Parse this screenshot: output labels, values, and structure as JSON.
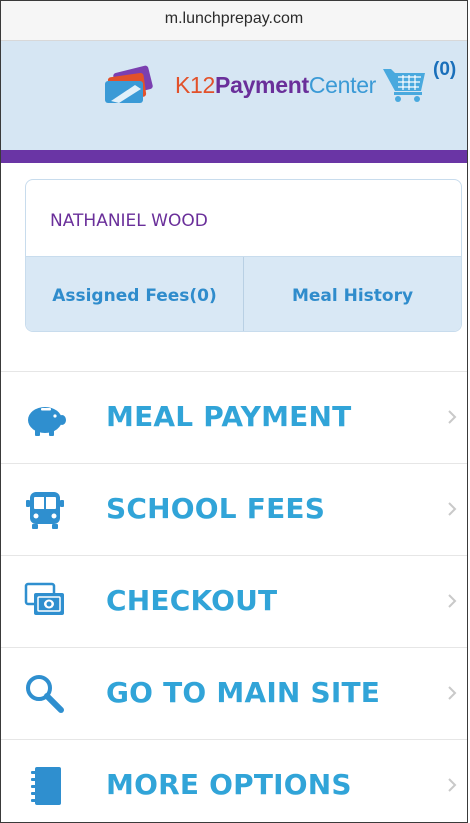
{
  "browser": {
    "url": "m.lunchprepay.com"
  },
  "header": {
    "logo": {
      "part1": "K12",
      "part2": "Payment",
      "part3": "Center"
    },
    "cart_count": "(0)",
    "accent_color": "#6a35a5",
    "header_bg": "#d6e6f3"
  },
  "student": {
    "name": "NATHANIEL WOOD",
    "links": [
      {
        "label": "Assigned Fees(0)"
      },
      {
        "label": "Meal History"
      }
    ]
  },
  "menu": {
    "items": [
      {
        "label": "MEAL PAYMENT",
        "icon": "piggy-bank-icon"
      },
      {
        "label": "SCHOOL FEES",
        "icon": "school-bus-icon"
      },
      {
        "label": "CHECKOUT",
        "icon": "money-icon"
      },
      {
        "label": "GO TO MAIN SITE",
        "icon": "search-icon"
      },
      {
        "label": "MORE OPTIONS",
        "icon": "notebook-icon"
      }
    ],
    "label_color": "#31a4d8",
    "icon_color": "#2f8fcf"
  }
}
